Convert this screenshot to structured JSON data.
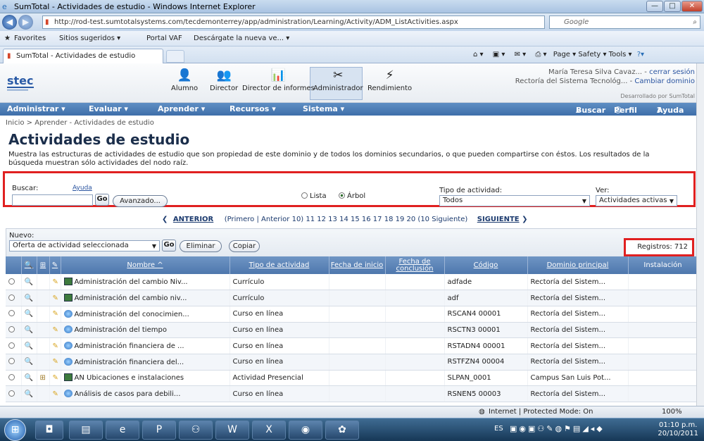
{
  "window": {
    "title": "SumTotal - Actividades de estudio - Windows Internet Explorer"
  },
  "browser": {
    "url": "http://rod-test.sumtotalsystems.com/tecdemonterrey/app/administration/Learning/Activity/ADM_ListActivities.aspx",
    "search_placeholder": "Google",
    "favorites": [
      "Favorites",
      "Sitios sugeridos ▾",
      "Portal VAF",
      "Descárgate la nueva ve... ▾"
    ],
    "tab_title": "SumTotal - Actividades de estudio",
    "tools": "Page ▾  Safety ▾  Tools ▾"
  },
  "app": {
    "toolbar": [
      "Alumno",
      "Director",
      "Director de informes",
      "Administrador",
      "Rendimiento"
    ],
    "user_name": "María Teresa Silva Cavaz... -",
    "logout": "cerrar sesión",
    "domain": "Rectoría del Sistema Tecnológ... -",
    "change_domain": "Cambiar dominio",
    "powered": "Desarrollado por SumTotal",
    "menu": [
      "Administrar ▾",
      "Evaluar ▾",
      "Aprender ▾",
      "Recursos ▾",
      "Sistema ▾"
    ],
    "menu_right": [
      "Buscar",
      "Perfil",
      "Ayuda"
    ]
  },
  "page": {
    "breadcrumb": "Inicio > Aprender - Actividades de estudio",
    "title": "Actividades de estudio",
    "description": "Muestra las estructuras de actividades de estudio que son propiedad de este dominio y de todos los dominios secundarios, o que pueden compartirse con éstos. Los resultados de la búsqueda muestran sólo actividades del nodo raíz."
  },
  "search": {
    "label": "Buscar:",
    "help": "Ayuda",
    "go": "Go",
    "advanced": "Avanzado...",
    "view_list": "Lista",
    "view_tree": "Árbol",
    "type_label": "Tipo de actividad:",
    "type_value": "Todos",
    "see_label": "Ver:",
    "see_value": "Actividades activas"
  },
  "pager": {
    "prev": "ANTERIOR",
    "mid": "(Primero | Anterior 10) 11 12 13 14 15 16 17 18 19 20 (10 Siguiente)",
    "next": "SIGUIENTE"
  },
  "grid_tools": {
    "new_label": "Nuevo:",
    "new_value": "Oferta de actividad seleccionada",
    "go": "Go",
    "delete": "Eliminar",
    "copy": "Copiar",
    "records": "Registros: 712"
  },
  "table": {
    "headers": [
      "Nombre ^",
      "Tipo de actividad",
      "Fecha de inicio",
      "Fecha de conclusión",
      "Código",
      "Dominio principal",
      "Instalación"
    ],
    "rows": [
      {
        "name": "Administración del cambio Niv...",
        "type": "Currículo",
        "code": "adfade",
        "domain": "Rectoría del Sistem...",
        "icon": "curriculum"
      },
      {
        "name": "Administración del cambio niv...",
        "type": "Currículo",
        "code": "adf",
        "domain": "Rectoría del Sistem...",
        "icon": "curriculum"
      },
      {
        "name": "Administración del conocimien...",
        "type": "Curso en línea",
        "code": "RSCAN4 00001",
        "domain": "Rectoría del Sistem...",
        "icon": "online"
      },
      {
        "name": "Administración del tiempo",
        "type": "Curso en línea",
        "code": "RSCTN3 00001",
        "domain": "Rectoría del Sistem...",
        "icon": "online"
      },
      {
        "name": "Administración financiera de ...",
        "type": "Curso en línea",
        "code": "RSTADN4 00001",
        "domain": "Rectoría del Sistem...",
        "icon": "online"
      },
      {
        "name": "Administración financiera del...",
        "type": "Curso en línea",
        "code": "RSTFZN4 00004",
        "domain": "Rectoría del Sistem...",
        "icon": "online"
      },
      {
        "name": "AN Ubicaciones e instalaciones",
        "type": "Actividad Presencial",
        "code": "SLPAN_0001",
        "domain": "Campus San Luis Pot...",
        "icon": "presencial"
      },
      {
        "name": "Análisis de casos para debili...",
        "type": "Curso en línea",
        "code": "RSNEN5 00003",
        "domain": "Rectoría del Sistem...",
        "icon": "online"
      }
    ]
  },
  "status": {
    "zone": "Internet | Protected Mode: On",
    "zoom": "100%"
  },
  "taskbar": {
    "lang": "ES",
    "time": "01:10 p.m.",
    "date": "20/10/2011"
  }
}
